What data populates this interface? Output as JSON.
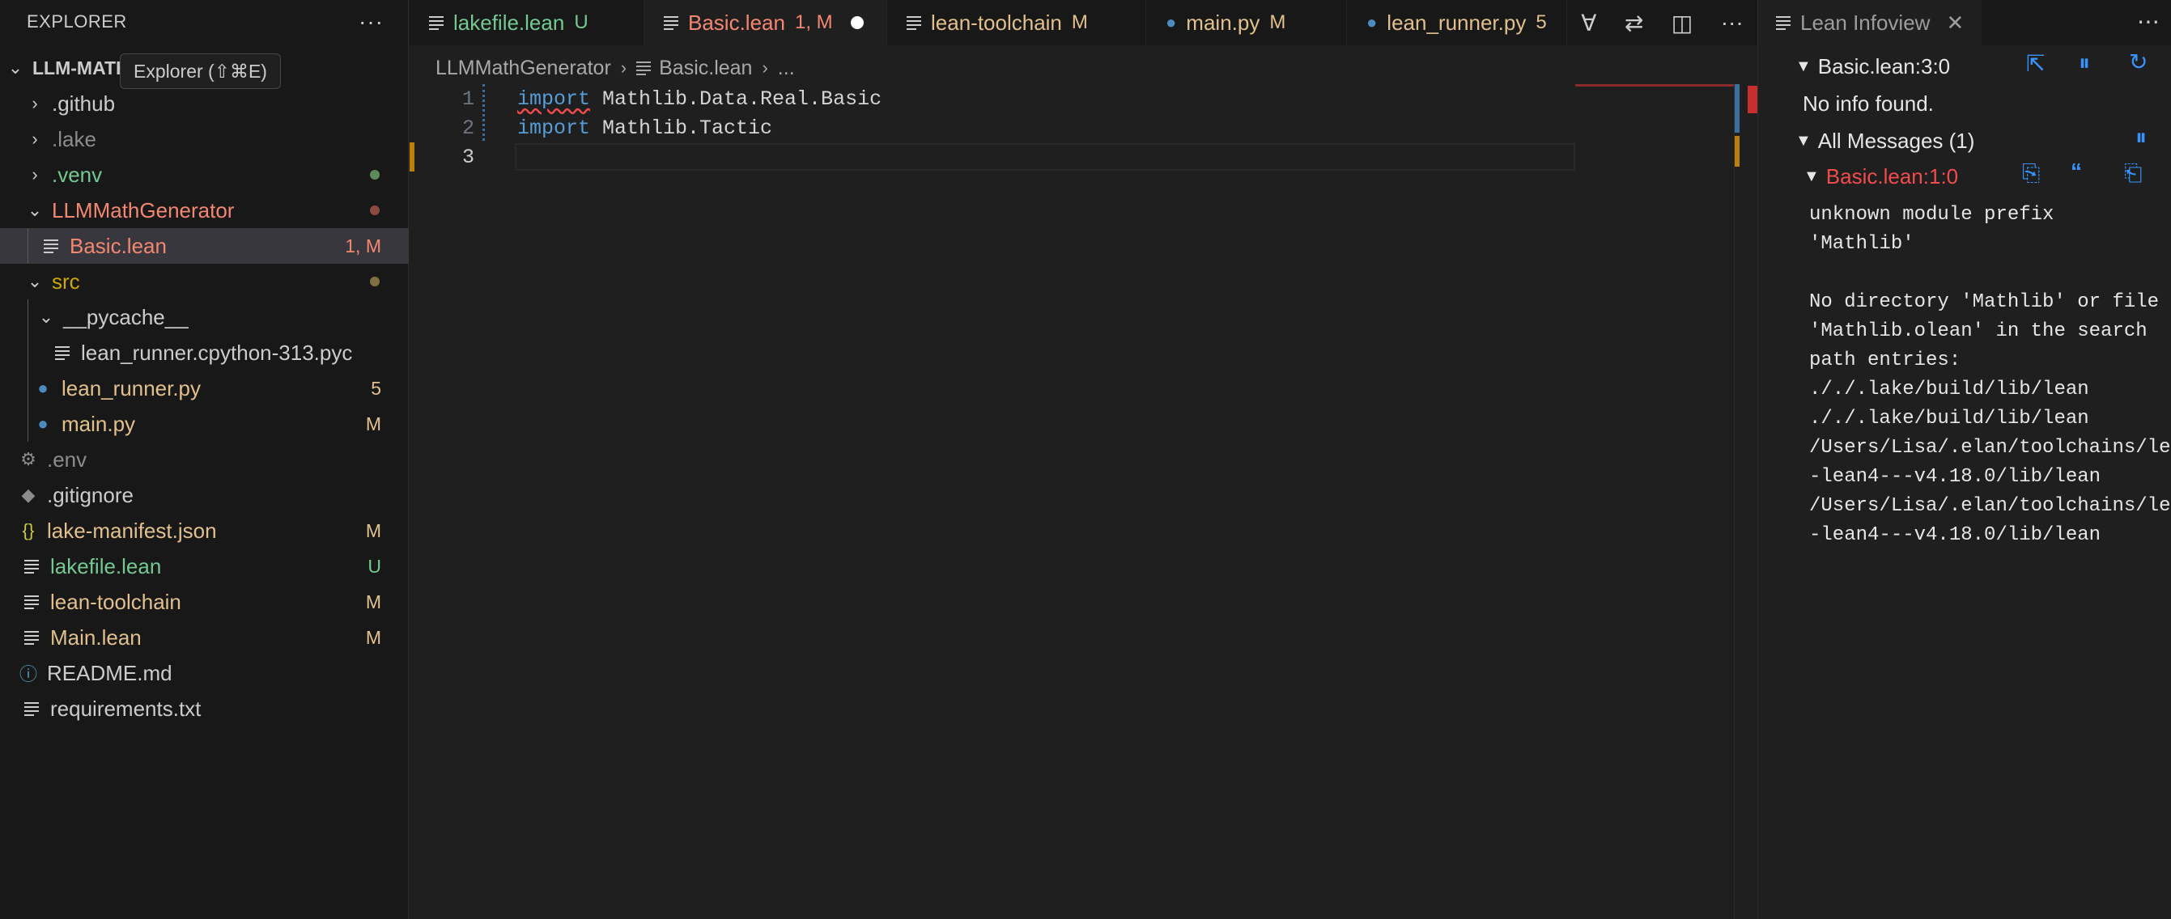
{
  "sidebar": {
    "title": "EXPLORER",
    "more": "···",
    "tooltip": "Explorer (⇧⌘E)",
    "root": "LLM-MATH",
    "items": [
      {
        "label": ".github",
        "badge": ""
      },
      {
        "label": ".lake",
        "badge": ""
      },
      {
        "label": ".venv",
        "badge": ""
      },
      {
        "label": "LLMMathGenerator",
        "badge": ""
      },
      {
        "label": "Basic.lean",
        "badge": "1, M"
      },
      {
        "label": "src",
        "badge": ""
      },
      {
        "label": "__pycache__",
        "badge": ""
      },
      {
        "label": "lean_runner.cpython-313.pyc",
        "badge": ""
      },
      {
        "label": "lean_runner.py",
        "badge": "5"
      },
      {
        "label": "main.py",
        "badge": "M"
      },
      {
        "label": ".env",
        "badge": ""
      },
      {
        "label": ".gitignore",
        "badge": ""
      },
      {
        "label": "lake-manifest.json",
        "badge": "M"
      },
      {
        "label": "lakefile.lean",
        "badge": "U"
      },
      {
        "label": "lean-toolchain",
        "badge": "M"
      },
      {
        "label": "Main.lean",
        "badge": "M"
      },
      {
        "label": "README.md",
        "badge": ""
      },
      {
        "label": "requirements.txt",
        "badge": ""
      }
    ]
  },
  "tabs": [
    {
      "label": "lakefile.lean",
      "status": "U"
    },
    {
      "label": "Basic.lean",
      "status": "1, M"
    },
    {
      "label": "lean-toolchain",
      "status": "M"
    },
    {
      "label": "main.py",
      "status": "M"
    },
    {
      "label": "lean_runner.py",
      "status": "5"
    }
  ],
  "tab_actions": {
    "more": "···"
  },
  "breadcrumb": {
    "folder": "LLMMathGenerator",
    "file": "Basic.lean",
    "ellipsis": "..."
  },
  "editor": {
    "lines": [
      {
        "num": "1",
        "kw": "import",
        "rest": " Mathlib.Data.Real.Basic"
      },
      {
        "num": "2",
        "kw": "import",
        "rest": " Mathlib.Tactic"
      },
      {
        "num": "3",
        "kw": "",
        "rest": ""
      }
    ]
  },
  "infoview": {
    "tab_title": "Lean Infoview",
    "goal_header": "Basic.lean:3:0",
    "no_info": "No info found.",
    "all_messages": "All Messages (1)",
    "message_header": "Basic.lean:1:0",
    "message_lines": [
      "unknown module prefix",
      "'Mathlib'",
      "",
      "No directory 'Mathlib' or file",
      "'Mathlib.olean' in the search",
      "path entries:",
      "././.lake/build/lib/lean",
      "././.lake/build/lib/lean",
      "/Users/Lisa/.elan/toolchains/le",
      "-lean4---v4.18.0/lib/lean",
      "/Users/Lisa/.elan/toolchains/le",
      "-lean4---v4.18.0/lib/lean"
    ]
  },
  "colors": {
    "accent": "#3794ff",
    "error": "#f14c4c",
    "added": "#73c991",
    "modified": "#e2c08d",
    "problem": "#f48771"
  }
}
